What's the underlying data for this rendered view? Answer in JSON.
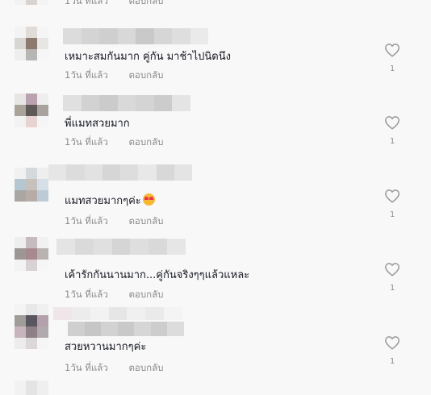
{
  "labels": {
    "time_ago": "1วัน ที่แล้ว",
    "reply": "ตอบกลับ"
  },
  "colors": {
    "text": "#161823",
    "meta": "#8a8a8a",
    "heart": "#9a9a9a",
    "background": "#f8f8f8"
  },
  "comments": [
    {
      "text": "เหมาะสมกันมาก คู่กัน มาช้าไปนิดนึง",
      "likes": "1"
    },
    {
      "text": "พี่แมทสวยมาก",
      "likes": "1"
    },
    {
      "text": "แมทสวยมากๆค่ะ",
      "emoji": "smiling-face-with-hearts",
      "likes": "1"
    },
    {
      "text": "เค้ารักกันนานมาก...คู่กันจริงๆๆแล้วแหละ",
      "likes": "1"
    },
    {
      "text": "สวยหวานมากๆค่ะ",
      "likes": "1"
    }
  ],
  "icons": {
    "like": "heart-outline-icon",
    "emoji": "smiling-face-with-hearts"
  }
}
